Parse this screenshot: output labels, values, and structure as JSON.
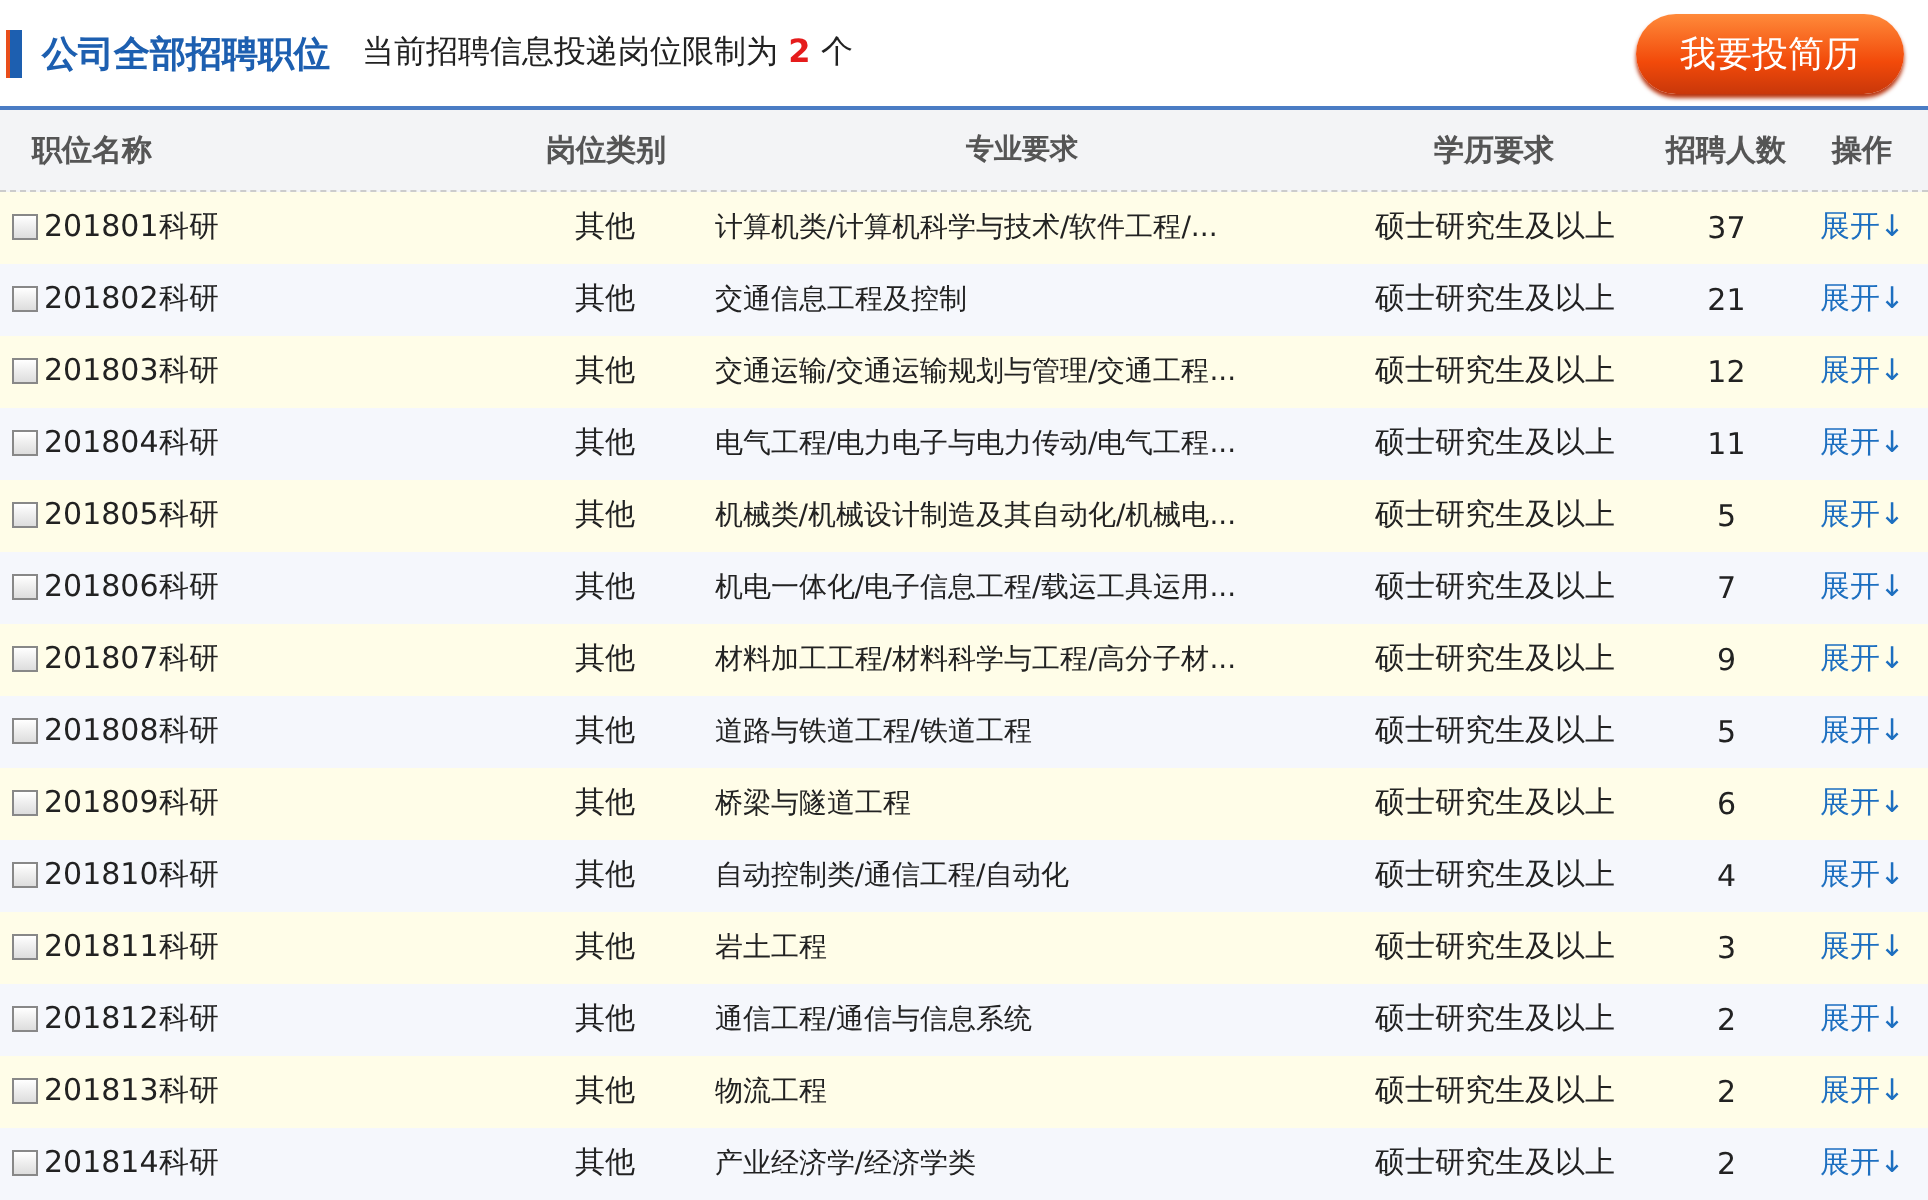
{
  "header": {
    "title": "公司全部招聘职位",
    "notice_prefix": "当前招聘信息投递岗位限制为",
    "notice_count": "2",
    "notice_suffix": "个",
    "apply_button": "我要投简历"
  },
  "table": {
    "columns": [
      "职位名称",
      "岗位类别",
      "专业要求",
      "学历要求",
      "招聘人数",
      "操作"
    ],
    "rows": [
      {
        "name": "201801科研",
        "category": "其他",
        "major": "计算机类/计算机科学与技术/软件工程/...",
        "degree": "硕士研究生及以上",
        "count": "37",
        "action": "展开↓",
        "checked": false
      },
      {
        "name": "201802科研",
        "category": "其他",
        "major": "交通信息工程及控制",
        "degree": "硕士研究生及以上",
        "count": "21",
        "action": "展开↓",
        "checked": false
      },
      {
        "name": "201803科研",
        "category": "其他",
        "major": "交通运输/交通运输规划与管理/交通工程...",
        "degree": "硕士研究生及以上",
        "count": "12",
        "action": "展开↓",
        "checked": false
      },
      {
        "name": "201804科研",
        "category": "其他",
        "major": "电气工程/电力电子与电力传动/电气工程...",
        "degree": "硕士研究生及以上",
        "count": "11",
        "action": "展开↓",
        "checked": false
      },
      {
        "name": "201805科研",
        "category": "其他",
        "major": "机械类/机械设计制造及其自动化/机械电...",
        "degree": "硕士研究生及以上",
        "count": "5",
        "action": "展开↓",
        "checked": false
      },
      {
        "name": "201806科研",
        "category": "其他",
        "major": "机电一体化/电子信息工程/载运工具运用...",
        "degree": "硕士研究生及以上",
        "count": "7",
        "action": "展开↓",
        "checked": false
      },
      {
        "name": "201807科研",
        "category": "其他",
        "major": "材料加工工程/材料科学与工程/高分子材...",
        "degree": "硕士研究生及以上",
        "count": "9",
        "action": "展开↓",
        "checked": false
      },
      {
        "name": "201808科研",
        "category": "其他",
        "major": "道路与铁道工程/铁道工程",
        "degree": "硕士研究生及以上",
        "count": "5",
        "action": "展开↓",
        "checked": false
      },
      {
        "name": "201809科研",
        "category": "其他",
        "major": "桥梁与隧道工程",
        "degree": "硕士研究生及以上",
        "count": "6",
        "action": "展开↓",
        "checked": false
      },
      {
        "name": "201810科研",
        "category": "其他",
        "major": "自动控制类/通信工程/自动化",
        "degree": "硕士研究生及以上",
        "count": "4",
        "action": "展开↓",
        "checked": false
      },
      {
        "name": "201811科研",
        "category": "其他",
        "major": "岩土工程",
        "degree": "硕士研究生及以上",
        "count": "3",
        "action": "展开↓",
        "checked": false
      },
      {
        "name": "201812科研",
        "category": "其他",
        "major": "通信工程/通信与信息系统",
        "degree": "硕士研究生及以上",
        "count": "2",
        "action": "展开↓",
        "checked": false
      },
      {
        "name": "201813科研",
        "category": "其他",
        "major": "物流工程",
        "degree": "硕士研究生及以上",
        "count": "2",
        "action": "展开↓",
        "checked": false
      },
      {
        "name": "201814科研",
        "category": "其他",
        "major": "产业经济学/经济学类",
        "degree": "硕士研究生及以上",
        "count": "2",
        "action": "展开↓",
        "checked": false
      }
    ]
  }
}
